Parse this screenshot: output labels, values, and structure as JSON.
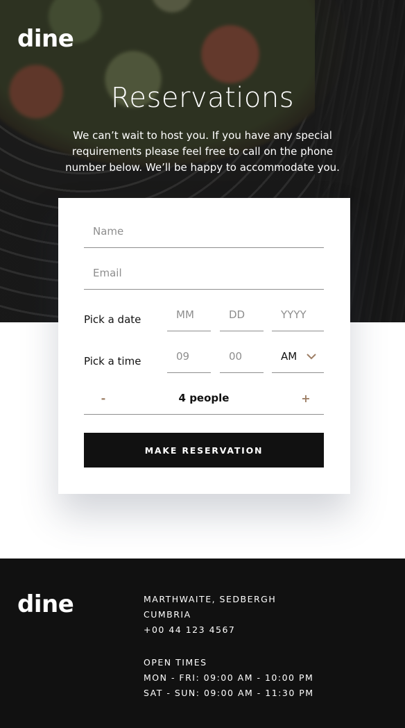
{
  "brand": {
    "logo": "dine"
  },
  "hero": {
    "title": "Reservations",
    "description": "We can’t wait to host you. If you have any special requirements please feel free to call on the phone number below. We’ll be happy to accommodate you."
  },
  "form": {
    "name_placeholder": "Name",
    "email_placeholder": "Email",
    "date_label": "Pick a date",
    "date_placeholders": {
      "month": "MM",
      "day": "DD",
      "year": "YYYY"
    },
    "time_label": "Pick a time",
    "time_placeholders": {
      "hour": "09",
      "minute": "00"
    },
    "ampm_value": "AM",
    "people": {
      "minus": "-",
      "plus": "+",
      "value": "4 people"
    },
    "submit_label": "MAKE RESERVATION"
  },
  "footer": {
    "address": [
      "MARTHWAITE, SEDBERGH",
      "CUMBRIA",
      "+00 44 123 4567"
    ],
    "hours": [
      "OPEN TIMES",
      "MON - FRI: 09:00 AM - 10:00 PM",
      "SAT - SUN: 09:00 AM - 11:30 PM"
    ]
  },
  "colors": {
    "accent": "#9e7f66",
    "dark": "#111111",
    "line": "#8e8e8e",
    "white": "#ffffff"
  },
  "icons": {
    "ampm_dropdown": "chevron-down-icon"
  }
}
